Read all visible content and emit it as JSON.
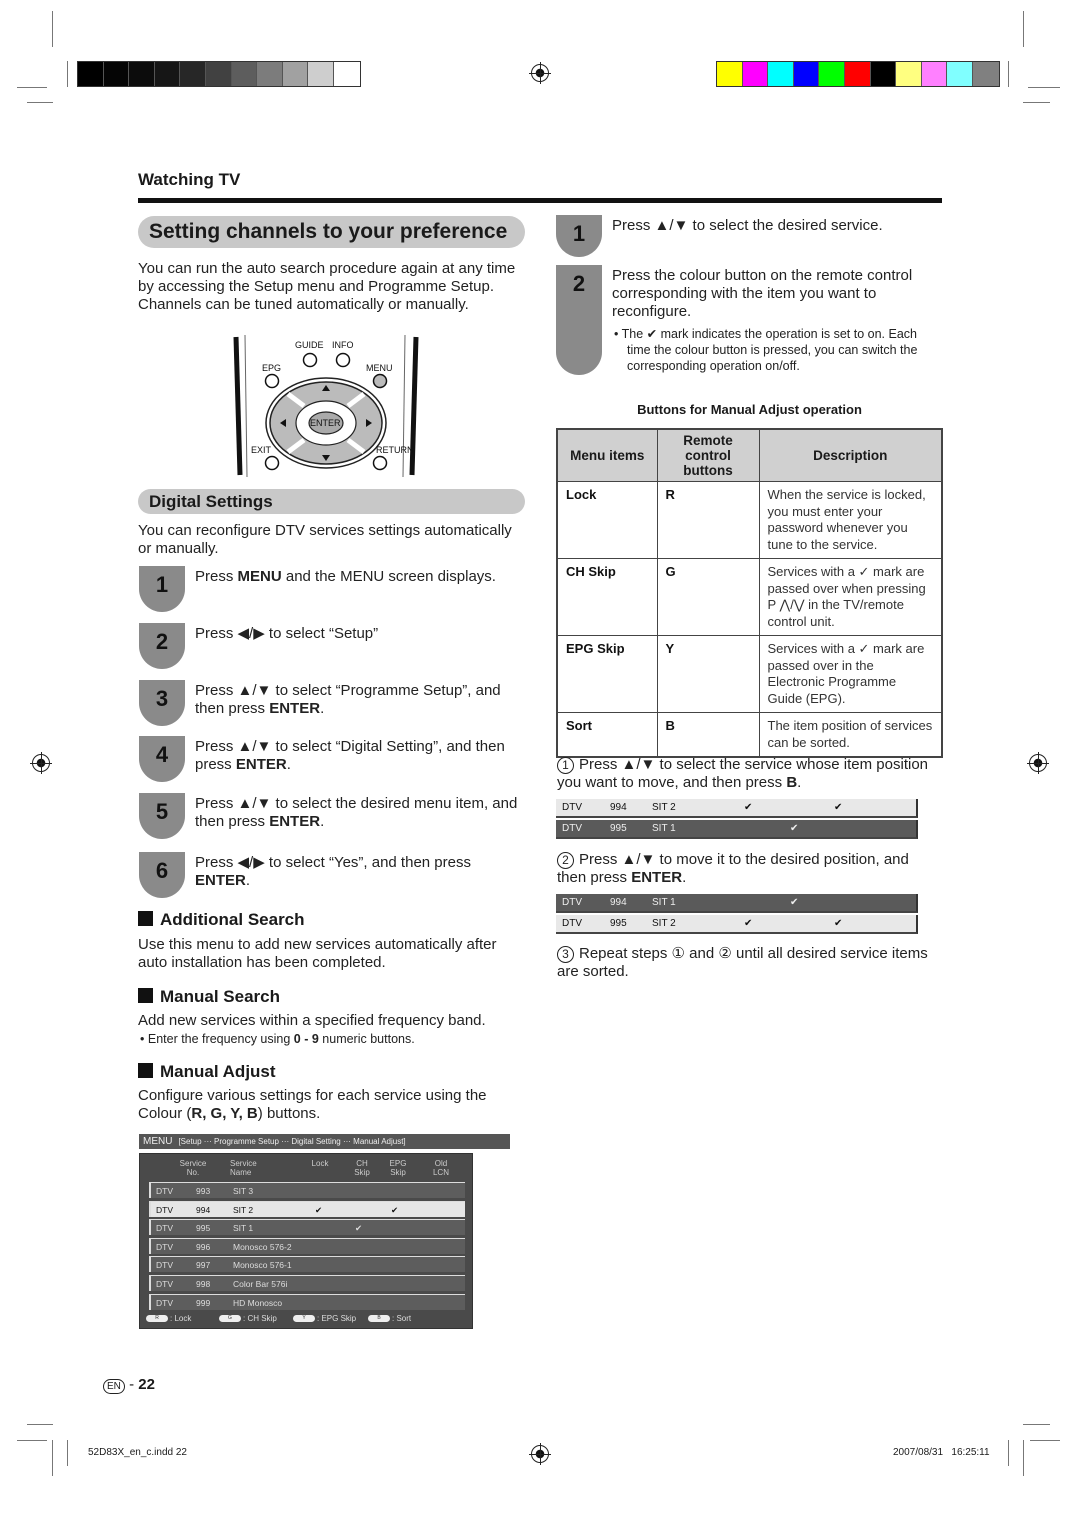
{
  "print_marks": {
    "gray_bar": [
      "#000000",
      "#050505",
      "#0c0c0c",
      "#161616",
      "#272727",
      "#414141",
      "#5d5d5d",
      "#7c7c7c",
      "#a1a1a1",
      "#cecece",
      "#ffffff"
    ],
    "color_bar": [
      "#ffff00",
      "#ff00ff",
      "#00ffff",
      "#0000ff",
      "#00ff00",
      "#ff0000",
      "#000000",
      "#ffff80",
      "#ff80ff",
      "#80ffff",
      "#808080"
    ],
    "file_label": "52D83X_en_c.indd   22",
    "timestamp": "2007/08/31   16:25:11"
  },
  "header": {
    "section": "Watching TV",
    "title": "Setting channels to your preference"
  },
  "intro": "You can run the auto search procedure again at any time by accessing the Setup menu and Programme Setup. Channels can be tuned automatically or manually.",
  "remote": {
    "labels": {
      "guide": "GUIDE",
      "info": "INFO",
      "epg": "EPG",
      "menu": "MENU",
      "enter": "ENTER",
      "exit": "EXIT",
      "return": "RETURN"
    }
  },
  "digital_settings": {
    "title": "Digital Settings",
    "intro": "You can reconfigure DTV services settings automatically or manually.",
    "steps": [
      {
        "num": "1",
        "pre": "Press ",
        "bold": "MENU",
        "post": " and the MENU screen displays."
      },
      {
        "num": "2",
        "pre": "Press ◀/▶ to select “Setup”",
        "bold": "",
        "post": ""
      },
      {
        "num": "3",
        "pre": "Press ▲/▼ to select “Programme Setup”, and then press ",
        "bold": "ENTER",
        "post": "."
      },
      {
        "num": "4",
        "pre": "Press ▲/▼ to select “Digital Setting”, and then press ",
        "bold": "ENTER",
        "post": "."
      },
      {
        "num": "5",
        "pre": "Press ▲/▼ to select the desired menu item, and then press ",
        "bold": "ENTER",
        "post": "."
      },
      {
        "num": "6",
        "pre": "Press ◀/▶ to select “Yes”, and then press ",
        "bold": "ENTER",
        "post": "."
      }
    ]
  },
  "additional_search": {
    "title": "Additional Search",
    "text": "Use this menu to add new services automatically after auto installation has been completed."
  },
  "manual_search": {
    "title": "Manual Search",
    "text": "Add new services within a specified frequency band.",
    "bullet_pre": "Enter the frequency using ",
    "bullet_bold": "0 - 9",
    "bullet_post": " numeric buttons."
  },
  "manual_adjust": {
    "title": "Manual Adjust",
    "text_pre": "Configure various settings for each service using the Colour (",
    "text_keys": "R, G, Y, B",
    "text_post": ") buttons."
  },
  "menu_screen": {
    "menu_label": "MENU",
    "path": "[Setup ··· Programme Setup ··· Digital Setting ··· Manual Adjust]",
    "columns": [
      "",
      "Service No.",
      "Service Name",
      "Lock",
      "CH Skip",
      "EPG Skip",
      "Old LCN"
    ],
    "rows": [
      {
        "type": "DTV",
        "no": "993",
        "name": "SIT 3",
        "lock": "",
        "ch": "",
        "epg": "",
        "selected": false
      },
      {
        "type": "DTV",
        "no": "994",
        "name": "SIT 2",
        "lock": "✔",
        "ch": "",
        "epg": "✔",
        "selected": true
      },
      {
        "type": "DTV",
        "no": "995",
        "name": "SIT 1",
        "lock": "",
        "ch": "✔",
        "epg": "",
        "selected": false
      },
      {
        "type": "DTV",
        "no": "996",
        "name": "Monosco 576-2",
        "lock": "",
        "ch": "",
        "epg": "",
        "selected": false
      },
      {
        "type": "DTV",
        "no": "997",
        "name": "Monosco 576-1",
        "lock": "",
        "ch": "",
        "epg": "",
        "selected": false
      },
      {
        "type": "DTV",
        "no": "998",
        "name": "Color Bar 576i",
        "lock": "",
        "ch": "",
        "epg": "",
        "selected": false
      },
      {
        "type": "DTV",
        "no": "999",
        "name": "HD Monosco",
        "lock": "",
        "ch": "",
        "epg": "",
        "selected": false
      }
    ],
    "legend": [
      {
        "key": "R",
        "label": ": Lock"
      },
      {
        "key": "G",
        "label": ": CH Skip"
      },
      {
        "key": "Y",
        "label": ": EPG Skip"
      },
      {
        "key": "B",
        "label": ": Sort"
      }
    ]
  },
  "right_steps": [
    {
      "num": "1",
      "text": "Press ▲/▼ to select the desired service."
    },
    {
      "num": "2",
      "text": "Press the colour button on the remote control corresponding with the item you want to reconfigure.",
      "bullet": "The ✔ mark indicates the operation is set to on. Each time the colour button is pressed, you can switch the corresponding operation on/off."
    }
  ],
  "buttons_table": {
    "caption": "Buttons for Manual Adjust operation",
    "headers": [
      "Menu items",
      "Remote control buttons",
      "Description"
    ],
    "rows": [
      {
        "item": "Lock",
        "button": "R",
        "desc": "When the service is locked, you must enter your password whenever you tune to the service."
      },
      {
        "item": "CH Skip",
        "button": "G",
        "desc": "Services with a ✓ mark are passed over when pressing P ⋀/⋁ in the TV/remote control unit."
      },
      {
        "item": "EPG Skip",
        "button": "Y",
        "desc": "Services with a ✓ mark are passed over in the Electronic Programme Guide (EPG)."
      },
      {
        "item": "Sort",
        "button": "B",
        "desc": "The item position of services can be sorted."
      }
    ]
  },
  "sort": {
    "step1_num": "1",
    "step1_pre": "Press ▲/▼ to select the service whose item position you want to move, and then press ",
    "step1_bold": "B",
    "step1_post": ".",
    "before": [
      {
        "type": "DTV",
        "no": "994",
        "name": "SIT 2",
        "lock": "✔",
        "ch": "",
        "epg": "✔",
        "style": "light"
      },
      {
        "type": "DTV",
        "no": "995",
        "name": "SIT 1",
        "lock": "",
        "ch": "✔",
        "epg": "",
        "style": "dark"
      }
    ],
    "step2_num": "2",
    "step2_pre": "Press ▲/▼ to move it to the desired position, and then press ",
    "step2_bold": "ENTER",
    "step2_post": ".",
    "after": [
      {
        "type": "DTV",
        "no": "994",
        "name": "SIT 1",
        "lock": "",
        "ch": "✔",
        "epg": "",
        "style": "dark"
      },
      {
        "type": "DTV",
        "no": "995",
        "name": "SIT 2",
        "lock": "✔",
        "ch": "",
        "epg": "✔",
        "style": "light"
      }
    ],
    "step3_num": "3",
    "step3_text": "Repeat steps ① and ② until all desired service items are sorted."
  },
  "footer": {
    "lang": "EN",
    "sep": "-",
    "page": "22"
  }
}
